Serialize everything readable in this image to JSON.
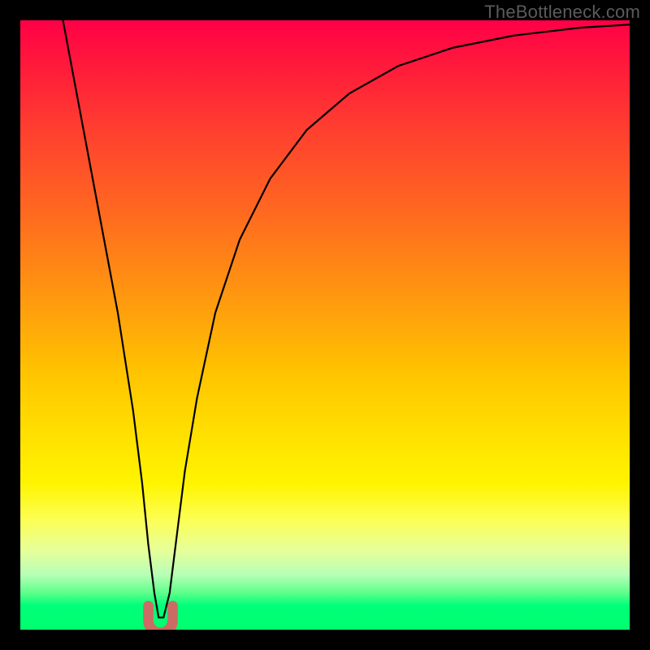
{
  "watermark": "TheBottleneck.com",
  "chart_data": {
    "type": "line",
    "title": "",
    "xlabel": "",
    "ylabel": "",
    "xlim": [
      0,
      100
    ],
    "ylim": [
      0,
      100
    ],
    "grid": false,
    "legend": false,
    "annotations": [],
    "background_gradient": {
      "direction": "vertical",
      "stops": [
        {
          "pos": 0,
          "color": "#ff0046"
        },
        {
          "pos": 18,
          "color": "#ff3f2f"
        },
        {
          "pos": 46,
          "color": "#ff9a0f"
        },
        {
          "pos": 68,
          "color": "#ffe000"
        },
        {
          "pos": 87,
          "color": "#e7ff9a"
        },
        {
          "pos": 100,
          "color": "#00ff6e"
        }
      ]
    },
    "series": [
      {
        "name": "bottleneck-curve",
        "stroke": "#000000",
        "x": [
          7,
          10,
          13,
          16,
          18.5,
          20,
          21,
          22,
          22.7,
          23.5,
          24.5,
          25.5,
          27,
          29,
          32,
          36,
          41,
          47,
          54,
          62,
          71,
          81,
          92,
          100
        ],
        "y": [
          100,
          84,
          68,
          52,
          36,
          24,
          14,
          6,
          2,
          2,
          6,
          14,
          26,
          38,
          52,
          64,
          74,
          82,
          88,
          92.5,
          95.5,
          97.5,
          98.8,
          99.3
        ]
      }
    ],
    "marker": {
      "name": "optimal-point-marker",
      "shape": "u",
      "color": "#cc6b63",
      "x": 23,
      "y": 1.5,
      "width": 4,
      "height": 4
    }
  }
}
